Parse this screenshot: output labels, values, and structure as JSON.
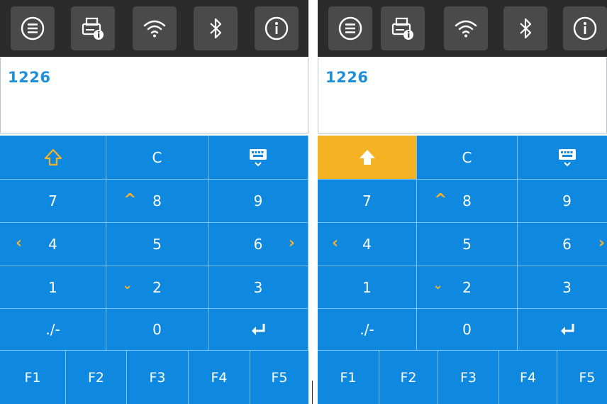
{
  "panels": [
    {
      "id": "left",
      "display_value": "1226",
      "shift_active": false,
      "keys": {
        "clear": "C",
        "n7": "7",
        "n8": "8",
        "n9": "9",
        "n4": "4",
        "n5": "5",
        "n6": "6",
        "n1": "1",
        "n2": "2",
        "n3": "3",
        "sym": "./-",
        "n0": "0"
      },
      "fkeys": [
        "F1",
        "F2",
        "F3",
        "F4",
        "F5"
      ]
    },
    {
      "id": "right",
      "display_value": "1226",
      "shift_active": true,
      "keys": {
        "clear": "C",
        "n7": "7",
        "n8": "8",
        "n9": "9",
        "n4": "4",
        "n5": "5",
        "n6": "6",
        "n1": "1",
        "n2": "2",
        "n3": "3",
        "sym": "./-",
        "n0": "0"
      },
      "fkeys": [
        "F1",
        "F2",
        "F3",
        "F4",
        "F5"
      ]
    }
  ],
  "toolbar_icons": [
    "menu-icon",
    "printer-info-icon",
    "wifi-icon",
    "bluetooth-icon",
    "info-icon"
  ],
  "colors": {
    "toolbar_bg": "#2b2b2b",
    "toolbar_button": "#4a4a4a",
    "keypad_blue": "#0f89e0",
    "accent_yellow": "#f5b324",
    "display_text": "#1e90d8"
  }
}
